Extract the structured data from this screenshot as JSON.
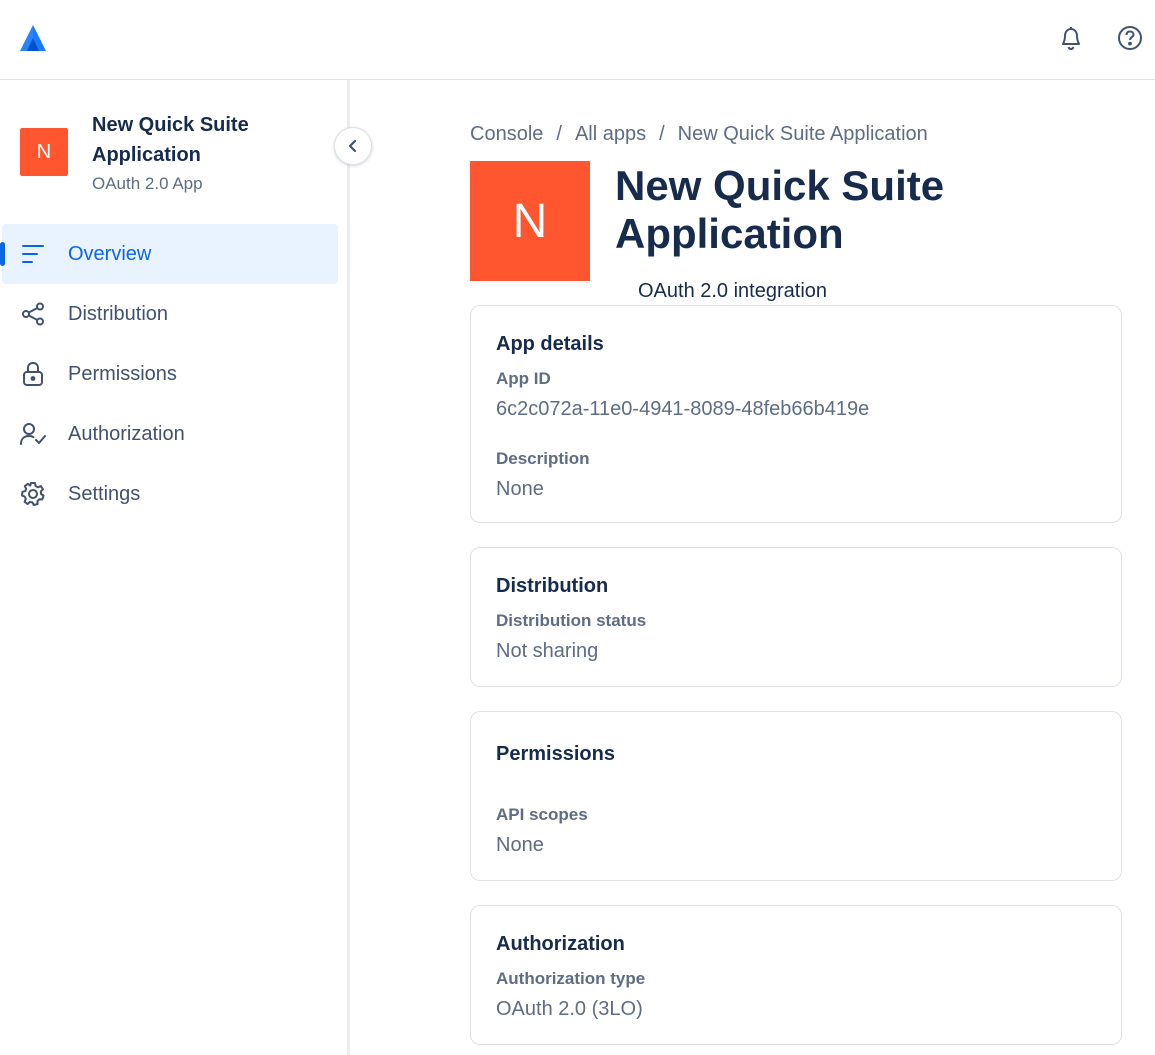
{
  "topbar": {
    "logo": "atlassian-logo",
    "icons": [
      "bell-icon",
      "help-icon"
    ]
  },
  "sidebar": {
    "app_initial": "N",
    "app_name": "New Quick Suite Application",
    "app_type": "OAuth 2.0 App",
    "items": [
      {
        "label": "Overview",
        "icon": "overview-icon",
        "active": true
      },
      {
        "label": "Distribution",
        "icon": "share-icon"
      },
      {
        "label": "Permissions",
        "icon": "lock-icon"
      },
      {
        "label": "Authorization",
        "icon": "user-check-icon"
      },
      {
        "label": "Settings",
        "icon": "gear-icon"
      }
    ]
  },
  "breadcrumb": {
    "items": [
      "Console",
      "All apps",
      "New Quick Suite Application"
    ],
    "separator": "/"
  },
  "hero": {
    "initial": "N",
    "title": "New Quick Suite Application",
    "subtitle": "OAuth 2.0 integration"
  },
  "cards": {
    "details": {
      "title": "App details",
      "app_id_label": "App ID",
      "app_id": "6c2c072a-11e0-4941-8089-48feb66b419e",
      "desc_label": "Description",
      "desc": "None"
    },
    "distribution": {
      "title": "Distribution",
      "status_label": "Distribution status",
      "status": "Not sharing"
    },
    "permissions": {
      "title": "Permissions",
      "scopes_label": "API scopes",
      "scopes": "None"
    },
    "authorization": {
      "title": "Authorization",
      "type_label": "Authorization type",
      "type": "OAuth 2.0 (3LO)"
    }
  },
  "colors": {
    "accent": "#0c66e4",
    "brand": "#ff5630",
    "text": "#172b4d",
    "muted": "#5e6c84"
  }
}
